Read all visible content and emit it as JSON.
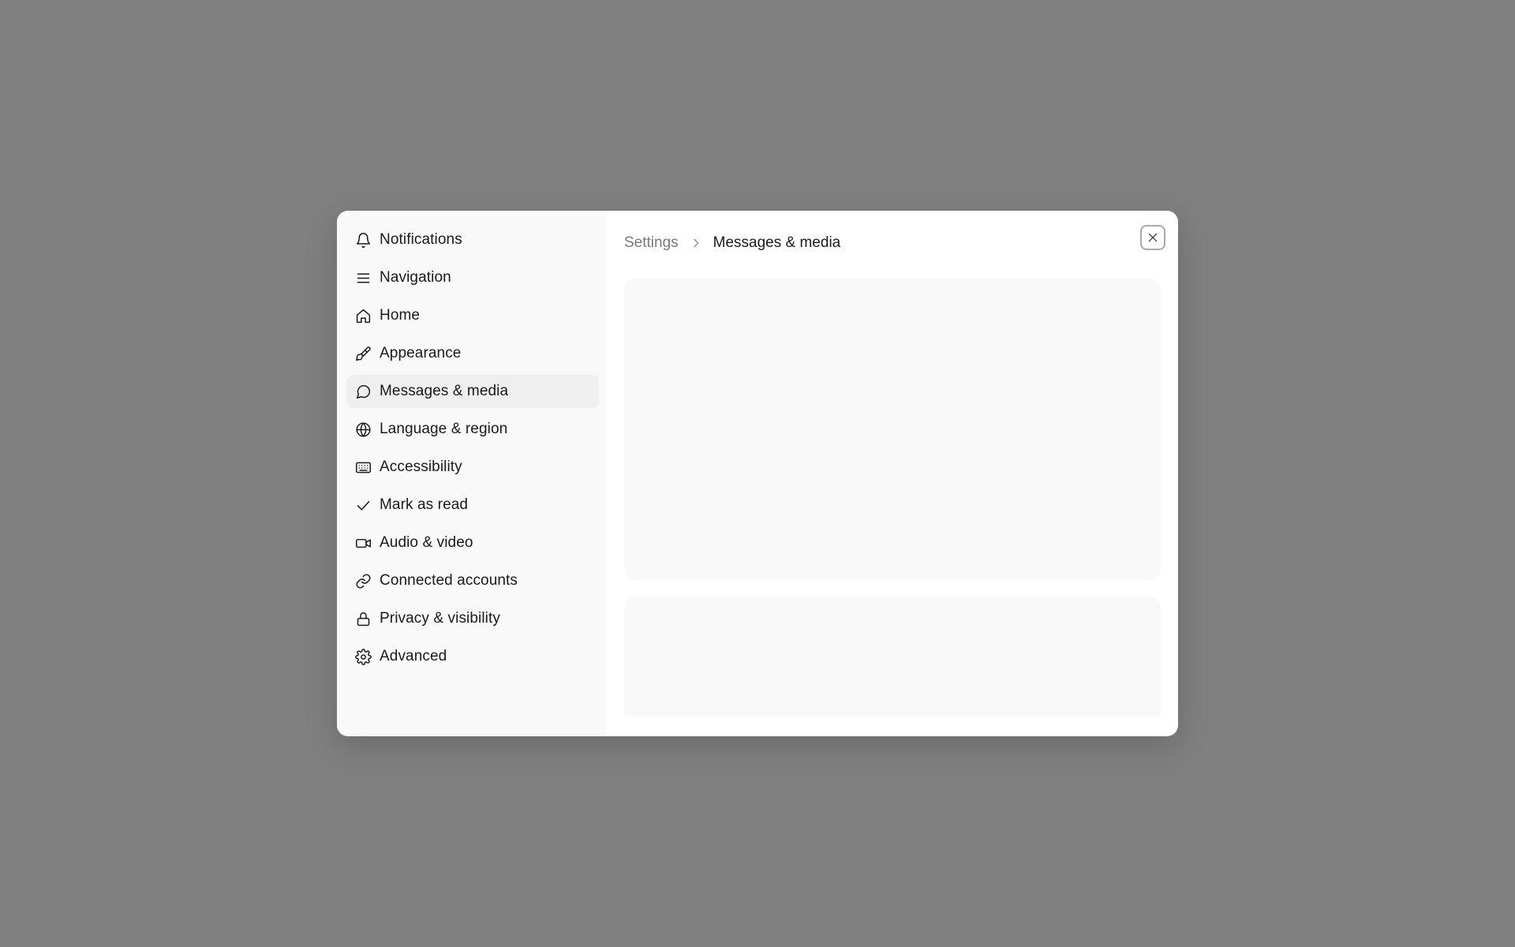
{
  "sidebar": {
    "items": [
      {
        "label": "Notifications",
        "icon": "bell-icon"
      },
      {
        "label": "Navigation",
        "icon": "menu-icon"
      },
      {
        "label": "Home",
        "icon": "home-icon"
      },
      {
        "label": "Appearance",
        "icon": "paintbrush-icon"
      },
      {
        "label": "Messages & media",
        "icon": "message-bubble-icon",
        "active": true
      },
      {
        "label": "Language & region",
        "icon": "globe-icon"
      },
      {
        "label": "Accessibility",
        "icon": "keyboard-icon"
      },
      {
        "label": "Mark as read",
        "icon": "check-icon"
      },
      {
        "label": "Audio & video",
        "icon": "video-camera-icon"
      },
      {
        "label": "Connected accounts",
        "icon": "link-icon"
      },
      {
        "label": "Privacy & visibility",
        "icon": "lock-icon"
      },
      {
        "label": "Advanced",
        "icon": "gear-icon"
      }
    ]
  },
  "breadcrumb": {
    "parent": "Settings",
    "current": "Messages & media"
  },
  "colors": {
    "backdrop": "#808080",
    "dialog": "#ffffff",
    "sidebar": "#f9f9f9",
    "active_item": "#efefef",
    "muted_text": "#7a7a7a",
    "text": "#1a1a1a"
  }
}
